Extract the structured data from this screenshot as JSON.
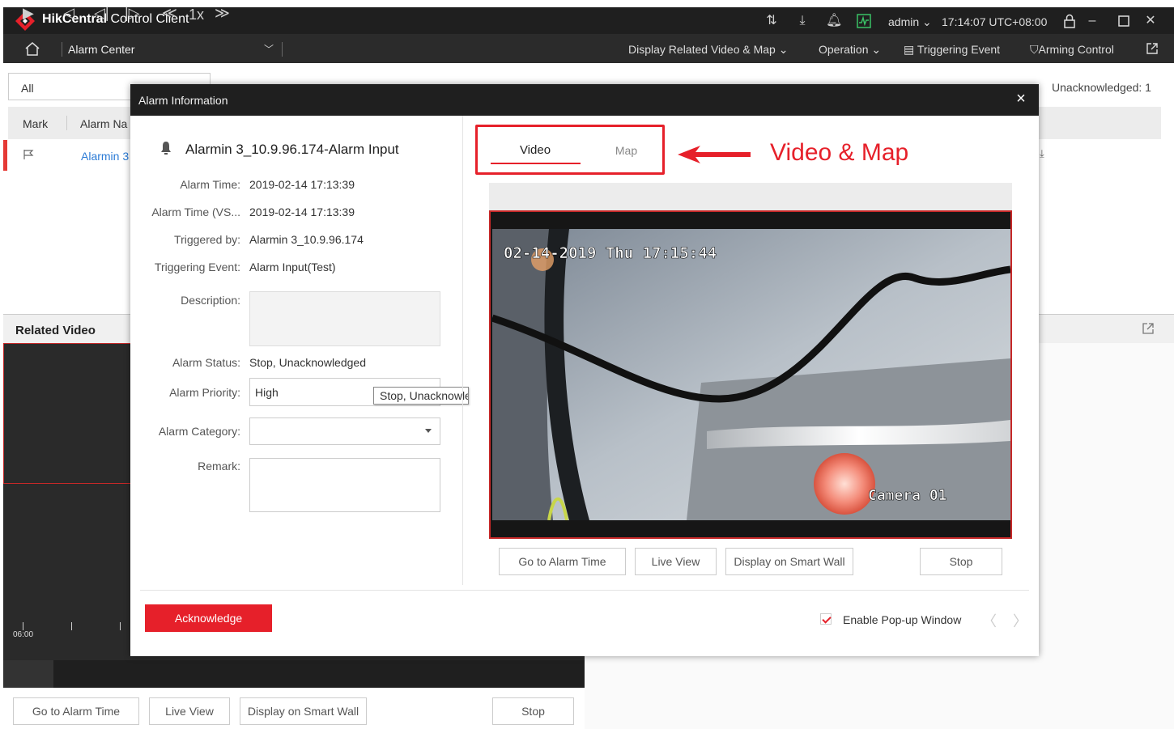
{
  "app": {
    "name_bold": "HikCentral",
    "name_rest": " Control Client",
    "user": "admin",
    "clock": "17:14:07 UTC+08:00"
  },
  "nav": {
    "module": "Alarm Center",
    "display_related": "Display Related Video & Map",
    "operation": "Operation",
    "triggering_event": "Triggering Event",
    "arming_control": "Arming Control"
  },
  "background": {
    "filter_value": "All",
    "unacknowledged": "Unacknowledged: 1",
    "columns": [
      "Mark",
      "Alarm Na"
    ],
    "row_name": "Alarmin 3",
    "related_video_title": "Related Video",
    "timeline_start": "06:00",
    "speed": "1x",
    "buttons": {
      "go_to_alarm_time": "Go to Alarm Time",
      "live_view": "Live View",
      "display_on_smart_wall": "Display on Smart Wall",
      "stop": "Stop"
    }
  },
  "modal": {
    "title": "Alarm Information",
    "alarm_name": "Alarmin 3_10.9.96.174-Alarm Input",
    "fields": {
      "alarm_time_label": "Alarm Time:",
      "alarm_time_value": "2019-02-14 17:13:39",
      "alarm_time_vs_label": "Alarm Time (VS...",
      "alarm_time_vs_value": "2019-02-14 17:13:39",
      "triggered_by_label": "Triggered by:",
      "triggered_by_value": "Alarmin 3_10.9.96.174",
      "triggering_event_label": "Triggering Event:",
      "triggering_event_value": "Alarm Input(Test)",
      "description_label": "Description:",
      "alarm_status_label": "Alarm Status:",
      "alarm_status_value": "Stop, Unacknowledged",
      "alarm_priority_label": "Alarm Priority:",
      "alarm_priority_value": "High",
      "alarm_category_label": "Alarm Category:",
      "alarm_category_value": "",
      "remark_label": "Remark:"
    },
    "tooltip": "Stop, Unacknowledged",
    "tabs": {
      "video": "Video",
      "map": "Map"
    },
    "annotation": "Video & Map",
    "osd": {
      "datetime": "02-14-2019 Thu 17:15:44",
      "camera": "Camera 01"
    },
    "video_buttons": {
      "go_to_alarm_time": "Go to Alarm Time",
      "live_view": "Live View",
      "display_on_smart_wall": "Display on Smart Wall",
      "stop": "Stop"
    },
    "acknowledge": "Acknowledge",
    "enable_popup": "Enable Pop-up Window",
    "enable_popup_checked": true
  },
  "colors": {
    "accent": "#e6202a",
    "titlebar": "#1f1f1f",
    "link": "#2b7bd6"
  }
}
